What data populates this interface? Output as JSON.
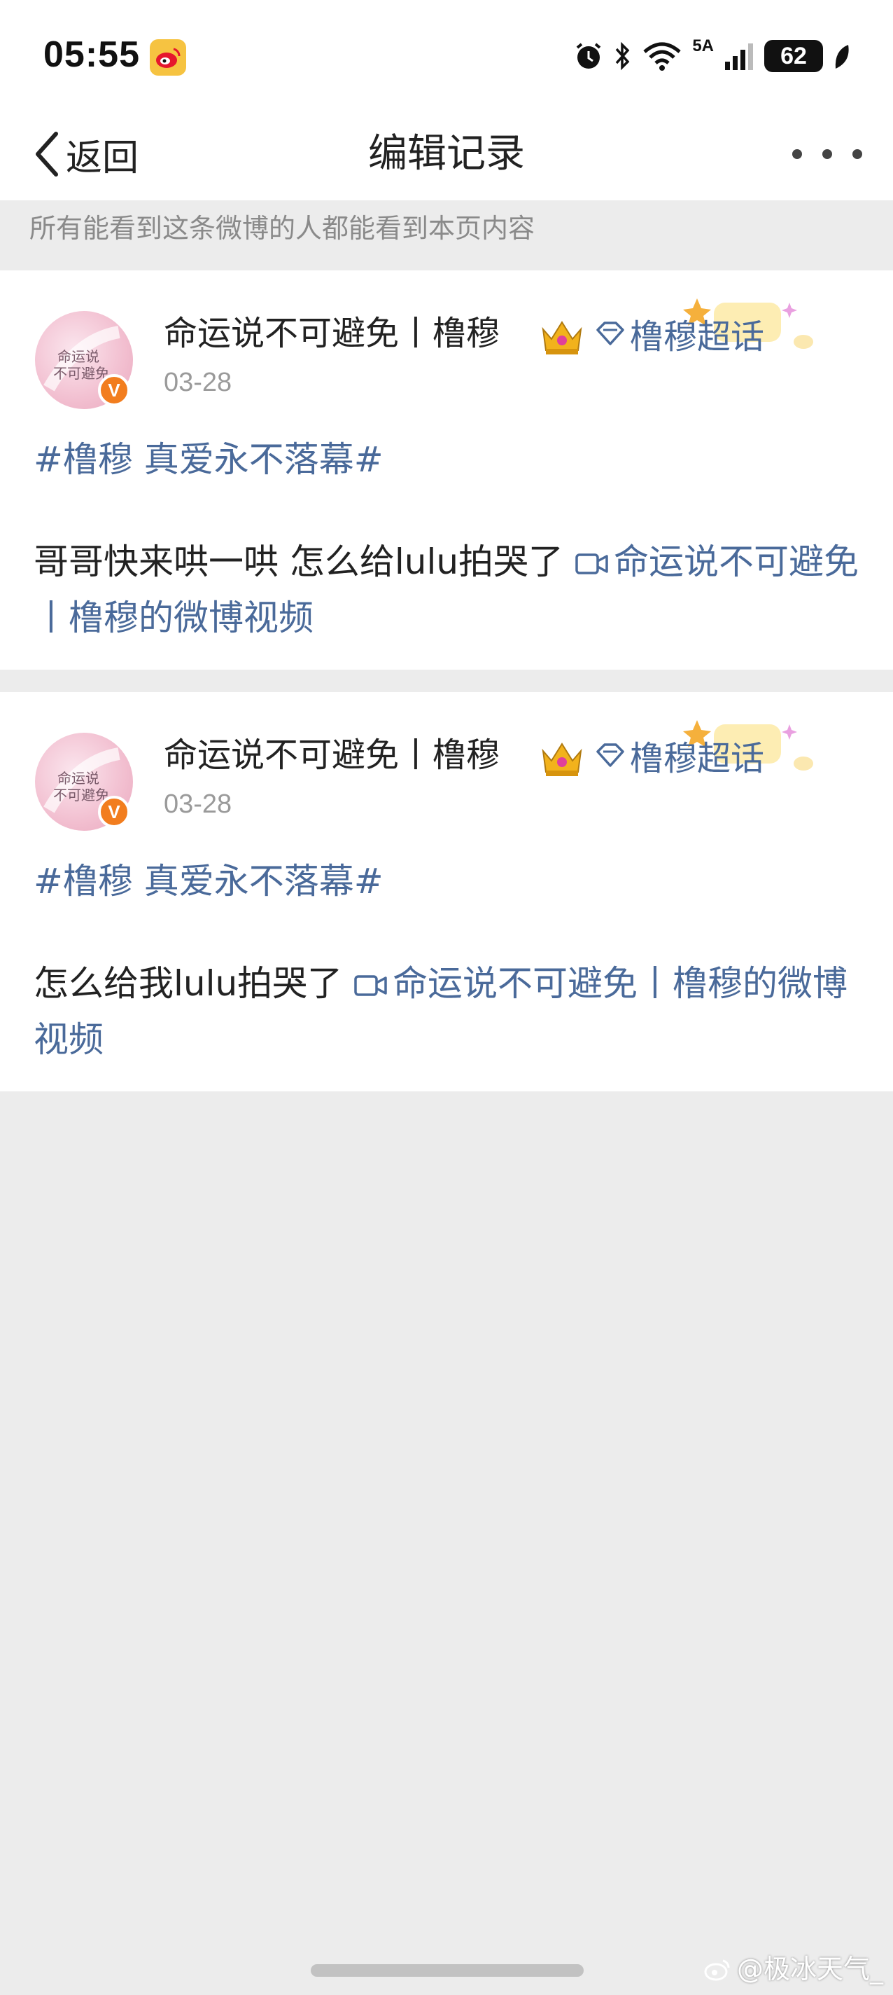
{
  "status_bar": {
    "time": "05:55",
    "network_label": "5A",
    "battery_level": "62"
  },
  "nav": {
    "back_label": "返回",
    "title": "编辑记录"
  },
  "notice": "所有能看到这条微博的人都能看到本页内容",
  "records": [
    {
      "user_name": "命运说不可避免丨橹穆",
      "topic_label": "橹穆超话",
      "date": "03-28",
      "hashtag": "#橹穆 真爱永不落幕#",
      "text": "哥哥快来哄一哄 怎么给lulu拍哭了 ",
      "video_link": "命运说不可避免丨橹穆的微博视频"
    },
    {
      "user_name": "命运说不可避免丨橹穆",
      "topic_label": "橹穆超话",
      "date": "03-28",
      "hashtag": "#橹穆 真爱永不落幕#",
      "text": "怎么给我lulu拍哭了 ",
      "video_link": "命运说不可避免丨橹穆的微博视频"
    }
  ],
  "watermark": "@极冰天气_",
  "icons": {
    "back": "chevron-left-icon",
    "more": "more-dots-icon",
    "crown": "crown-icon",
    "topic": "diamond-icon",
    "video": "video-camera-icon",
    "verified": "verified-badge-icon"
  },
  "colors": {
    "link": "#4a6a9a",
    "verified": "#f27d1e",
    "background": "#ececec"
  }
}
